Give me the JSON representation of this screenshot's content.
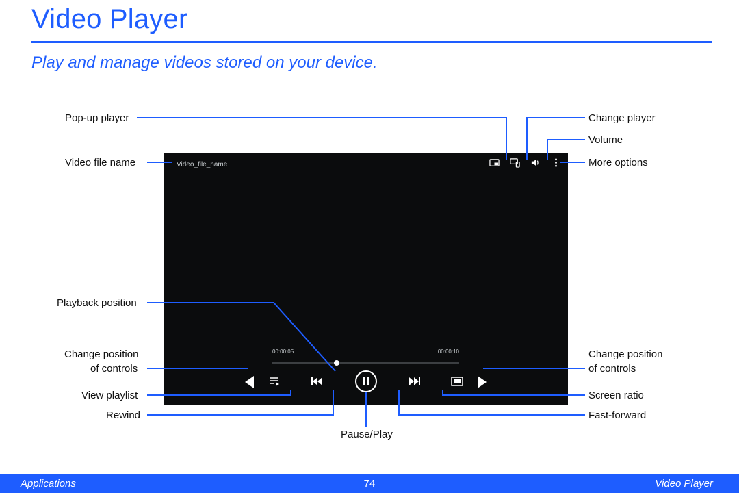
{
  "header": {
    "title": "Video Player",
    "subtitle": "Play and manage videos stored on your device."
  },
  "screenshot": {
    "filename": "Video_file_name",
    "time_elapsed": "00:00:05",
    "time_total": "00:00:10"
  },
  "callouts": {
    "left": {
      "popup": "Pop-up player",
      "filename": "Video file name",
      "playback_pos": "Playback position",
      "change_pos1": "Change position",
      "change_pos2": "of controls",
      "playlist": "View playlist",
      "rewind": "Rewind"
    },
    "right": {
      "change_player": "Change player",
      "volume": "Volume",
      "more": "More options",
      "change_pos1": "Change position",
      "change_pos2": "of controls",
      "screen_ratio": "Screen ratio",
      "ffwd": "Fast-forward"
    },
    "bottom": {
      "pauseplay": "Pause/Play"
    }
  },
  "footer": {
    "left": "Applications",
    "page": "74",
    "right": "Video Player"
  }
}
